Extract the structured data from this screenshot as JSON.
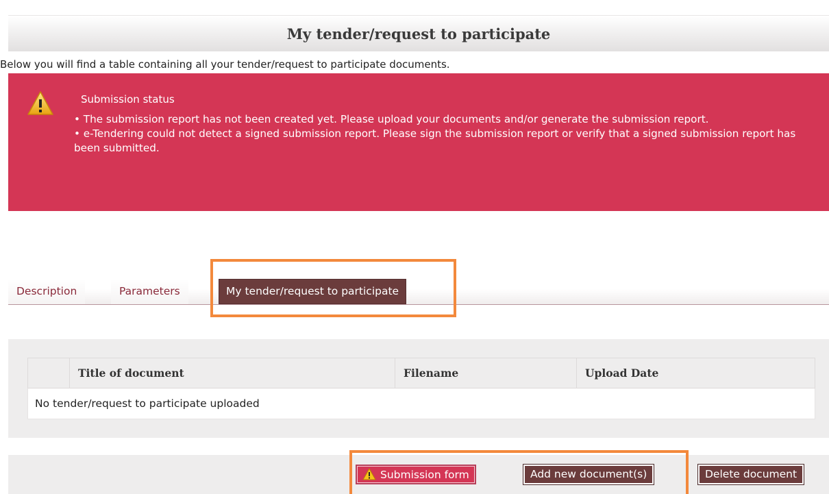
{
  "page": {
    "title": "My tender/request to participate",
    "intro": "Below you will find a table containing all your tender/request to participate documents."
  },
  "status": {
    "title": "Submission status",
    "icon": "warning-icon",
    "background_color": "#d43655",
    "messages": [
      "• The submission report has not been created yet. Please upload your documents and/or generate the submission report.",
      "• e-Tendering could not detect a signed submission report. Please sign the submission report or verify that a signed submission report has been submitted."
    ]
  },
  "tabs": [
    {
      "label": "Description",
      "active": false
    },
    {
      "label": "Parameters",
      "active": false
    },
    {
      "label": "My tender/request to participate",
      "active": true
    }
  ],
  "table": {
    "columns": [
      "",
      "Title of document",
      "Filename",
      "Upload Date"
    ],
    "empty_message": "No tender/request to participate uploaded"
  },
  "actions": {
    "submission_form": "Submission form",
    "add_documents": "Add new document(s)",
    "delete_document": "Delete document"
  },
  "colors": {
    "accent_dark": "#6b3c3c",
    "alert_red": "#d43655",
    "highlight_orange": "#f3893c"
  }
}
